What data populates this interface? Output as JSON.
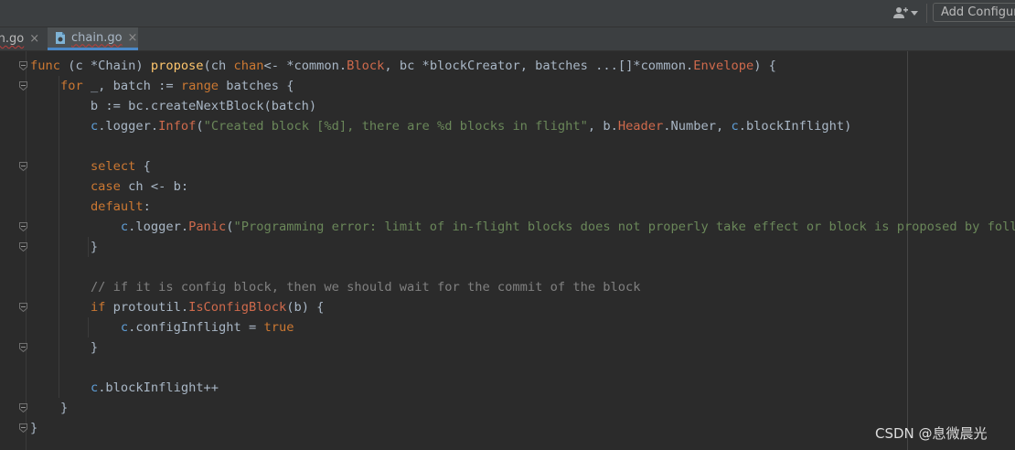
{
  "toolbar": {
    "user_icon": "user-dropdown-icon",
    "add_configuration_label": "Add Configura"
  },
  "tabs": [
    {
      "label": "in.go",
      "close": "×",
      "active": false
    },
    {
      "label": "chain.go",
      "close": "×",
      "active": true,
      "icon": "go-file-icon"
    }
  ],
  "code": {
    "lines": [
      [
        [
          "kw",
          "func"
        ],
        [
          "plain",
          " (c *"
        ],
        [
          "ty",
          "Chain"
        ],
        [
          "plain",
          ") "
        ],
        [
          "fn",
          "propose"
        ],
        [
          "plain",
          "(ch "
        ],
        [
          "kw",
          "chan"
        ],
        [
          "plain",
          "<- *"
        ],
        [
          "pkg",
          "common"
        ],
        [
          "plain",
          "."
        ],
        [
          "red",
          "Block"
        ],
        [
          "plain",
          ", bc *"
        ],
        [
          "ty",
          "blockCreator"
        ],
        [
          "plain",
          ", batches ...[]*"
        ],
        [
          "pkg",
          "common"
        ],
        [
          "plain",
          "."
        ],
        [
          "red",
          "Envelope"
        ],
        [
          "plain",
          ") {"
        ]
      ],
      [
        [
          "plain",
          "    "
        ],
        [
          "kw",
          "for"
        ],
        [
          "plain",
          " _, batch := "
        ],
        [
          "kw",
          "range"
        ],
        [
          "plain",
          " batches {"
        ]
      ],
      [
        [
          "plain",
          "        b := bc.createNextBlock(batch)"
        ]
      ],
      [
        [
          "plain",
          "        "
        ],
        [
          "rcv",
          "c"
        ],
        [
          "plain",
          ".logger."
        ],
        [
          "red",
          "Infof"
        ],
        [
          "plain",
          "("
        ],
        [
          "str",
          "\"Created block [%d], there are %d blocks in flight\""
        ],
        [
          "plain",
          ", b."
        ],
        [
          "red",
          "Header"
        ],
        [
          "plain",
          ".Number, "
        ],
        [
          "rcv",
          "c"
        ],
        [
          "plain",
          ".blockInflight)"
        ]
      ],
      [],
      [
        [
          "plain",
          "        "
        ],
        [
          "kw",
          "select"
        ],
        [
          "plain",
          " {"
        ]
      ],
      [
        [
          "plain",
          "        "
        ],
        [
          "kw",
          "case"
        ],
        [
          "plain",
          " ch <- b:"
        ]
      ],
      [
        [
          "plain",
          "        "
        ],
        [
          "kw",
          "default"
        ],
        [
          "plain",
          ":"
        ]
      ],
      [
        [
          "plain",
          "            "
        ],
        [
          "rcv",
          "c"
        ],
        [
          "plain",
          ".logger."
        ],
        [
          "red",
          "Panic"
        ],
        [
          "plain",
          "("
        ],
        [
          "str",
          "\"Programming error: limit of in-flight blocks does not properly take effect or block is proposed by follower\""
        ],
        [
          "plain",
          ")"
        ]
      ],
      [
        [
          "plain",
          "        }"
        ]
      ],
      [],
      [
        [
          "plain",
          "        "
        ],
        [
          "cm",
          "// if it is config block, then we should wait for the commit of the block"
        ]
      ],
      [
        [
          "plain",
          "        "
        ],
        [
          "kw",
          "if"
        ],
        [
          "plain",
          " protoutil."
        ],
        [
          "red",
          "IsConfigBlock"
        ],
        [
          "plain",
          "(b) {"
        ]
      ],
      [
        [
          "plain",
          "            "
        ],
        [
          "rcv",
          "c"
        ],
        [
          "plain",
          ".configInflight = "
        ],
        [
          "kw",
          "true"
        ]
      ],
      [
        [
          "plain",
          "        }"
        ]
      ],
      [],
      [
        [
          "plain",
          "        "
        ],
        [
          "rcv",
          "c"
        ],
        [
          "plain",
          ".blockInflight++"
        ]
      ],
      [
        [
          "plain",
          "    }"
        ]
      ],
      [
        [
          "plain",
          "}"
        ]
      ]
    ]
  },
  "watermark": "CSDN @息微晨光",
  "colors": {
    "background": "#2b2b2b",
    "keyword": "#cc7832",
    "function": "#ffc66d",
    "string": "#6a8759",
    "comment": "#808080",
    "accent": "#4a88c7"
  }
}
